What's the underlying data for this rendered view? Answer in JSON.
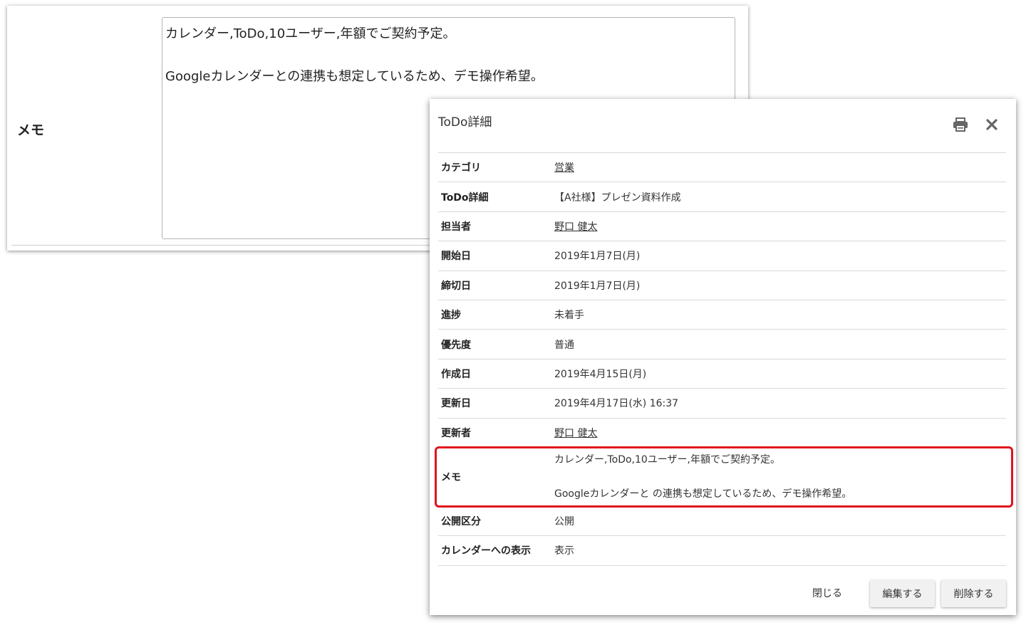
{
  "form": {
    "memo_label": "メモ",
    "memo_value": "カレンダー,ToDo,10ユーザー,年額でご契約予定。\n\nGoogleカレンダーとの連携も想定しているため、デモ操作希望。"
  },
  "modal": {
    "title": "ToDo詳細",
    "print_icon": "printer-icon",
    "close_icon": "close-icon",
    "rows": [
      {
        "label": "カテゴリ",
        "value": "営業"
      },
      {
        "label": "ToDo詳細",
        "value": "【A社様】プレゼン資料作成"
      },
      {
        "label": "担当者",
        "value": "野口 健太"
      },
      {
        "label": "開始日",
        "value": "2019年1月7日(月)"
      },
      {
        "label": "締切日",
        "value": "2019年1月7日(月)"
      },
      {
        "label": "進捗",
        "value": "未着手"
      },
      {
        "label": "優先度",
        "value": "普通"
      },
      {
        "label": "作成日",
        "value": "2019年4月15日(月)"
      },
      {
        "label": "更新日",
        "value": "2019年4月17日(水) 16:37"
      },
      {
        "label": "更新者",
        "value": "野口 健太"
      },
      {
        "label": "メモ",
        "value": "カレンダー,ToDo,10ユーザー,年額でご契約予定。\n\nGoogleカレンダーと の連携も想定しているため、デモ操作希望。"
      },
      {
        "label": "公開区分",
        "value": "公開"
      },
      {
        "label": "カレンダーへの表示",
        "value": "表示"
      }
    ],
    "buttons": {
      "close": "閉じる",
      "edit": "編集する",
      "delete": "削除する"
    },
    "highlight_color": "#e0141e"
  }
}
